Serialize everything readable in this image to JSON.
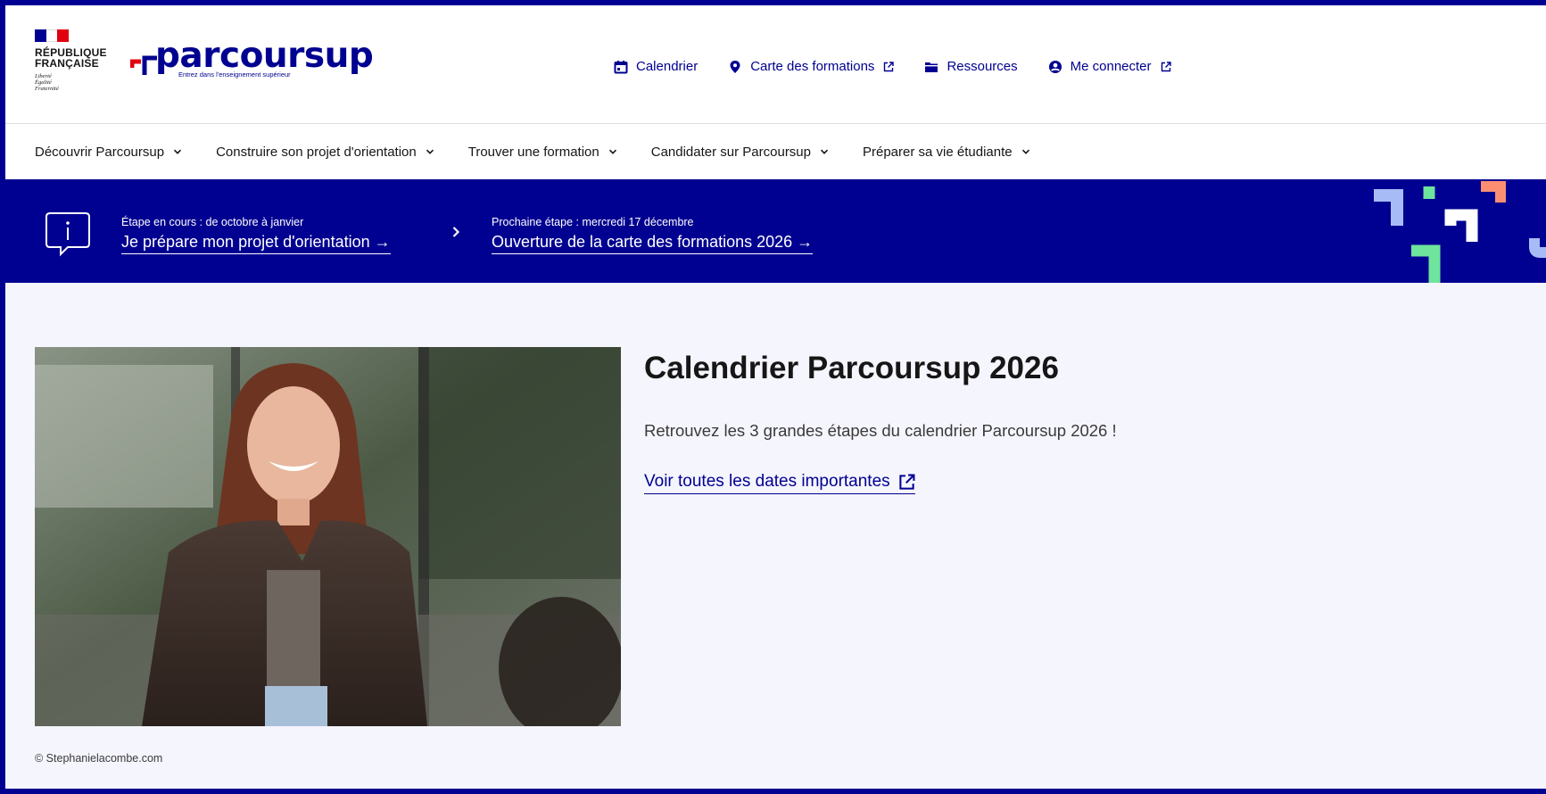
{
  "header": {
    "republique": [
      "RÉPUBLIQUE",
      "FRANÇAISE"
    ],
    "devise": [
      "Liberté",
      "Égalité",
      "Fraternité"
    ],
    "logo_word": "parcoursup",
    "logo_tagline": "Entrez dans l'enseignement supérieur",
    "top_links": [
      {
        "label": "Calendrier",
        "icon": "calendar-icon",
        "external": false
      },
      {
        "label": "Carte des formations",
        "icon": "map-pin-icon",
        "external": true
      },
      {
        "label": "Ressources",
        "icon": "folder-icon",
        "external": false
      },
      {
        "label": "Me connecter",
        "icon": "account-icon",
        "external": true
      }
    ]
  },
  "main_nav": {
    "items": [
      "Découvrir Parcoursup",
      "Construire son projet d'orientation",
      "Trouver une formation",
      "Candidater sur Parcoursup",
      "Préparer sa vie étudiante"
    ]
  },
  "banner": {
    "current_step": {
      "small": "Étape en cours : de octobre à janvier",
      "link": "Je prépare mon projet d'orientation →"
    },
    "next_step": {
      "small": "Prochaine étape : mercredi 17 décembre",
      "link": "Ouverture de la carte des formations 2026 →"
    }
  },
  "content": {
    "title": "Calendrier Parcoursup 2026",
    "intro": "Retrouvez les 3 grandes étapes du calendrier Parcoursup 2026 !",
    "link": "Voir toutes les dates importantes",
    "credit": "© Stephanielacombe.com"
  },
  "colors": {
    "primary_blue": "#000091",
    "flag_red": "#e1000f",
    "background_light": "#f5f5fe",
    "deco_blue": "#a7bcf6",
    "deco_green": "#6fe49d",
    "deco_salmon": "#fc8e72"
  }
}
